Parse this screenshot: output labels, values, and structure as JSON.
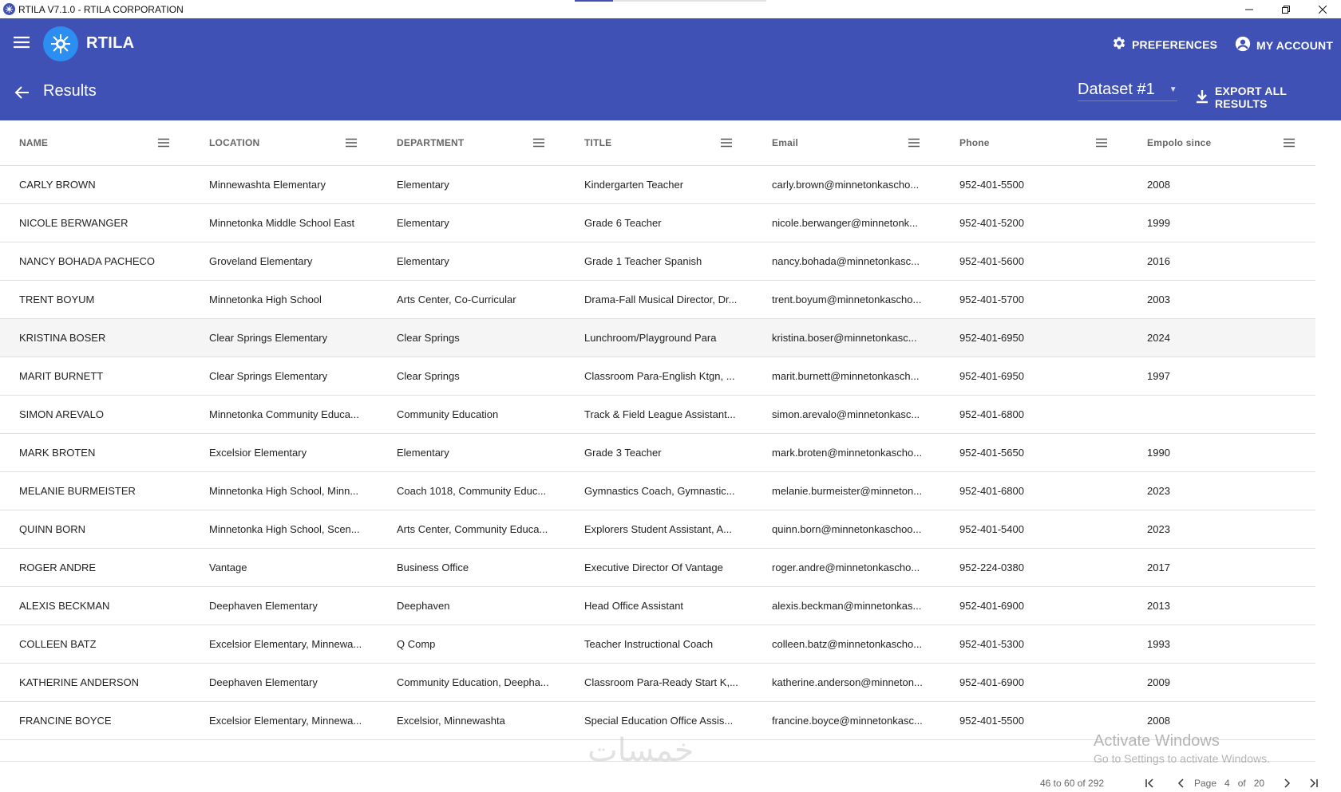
{
  "window": {
    "title": "RTILA V7.1.0 - RTILA CORPORATION",
    "loading_progress": 0.2
  },
  "header": {
    "brand": "RTILA",
    "preferences_label": "PREFERENCES",
    "account_label": "MY ACCOUNT",
    "page_title": "Results",
    "dataset_label": "Dataset #1",
    "export_label": "EXPORT ALL RESULTS",
    "accent": "#3f51b5"
  },
  "table": {
    "columns": [
      {
        "label": "NAME"
      },
      {
        "label": "LOCATION"
      },
      {
        "label": "DEPARTMENT"
      },
      {
        "label": "TITLE"
      },
      {
        "label": "Email"
      },
      {
        "label": "Phone"
      },
      {
        "label": "Empolo since"
      }
    ],
    "rows": [
      [
        "CARLY BROWN",
        "Minnewashta Elementary",
        "Elementary",
        "Kindergarten Teacher",
        "carly.brown@minnetonkascho...",
        "952-401-5500",
        "2008"
      ],
      [
        "NICOLE BERWANGER",
        "Minnetonka Middle School East",
        "Elementary",
        "Grade 6 Teacher",
        "nicole.berwanger@minnetonk...",
        "952-401-5200",
        "1999"
      ],
      [
        "NANCY BOHADA PACHECO",
        "Groveland Elementary",
        "Elementary",
        "Grade 1 Teacher Spanish",
        "nancy.bohada@minnetonkasc...",
        "952-401-5600",
        "2016"
      ],
      [
        "TRENT BOYUM",
        "Minnetonka High School",
        "Arts Center, Co-Curricular",
        "Drama-Fall Musical Director, Dr...",
        "trent.boyum@minnetonkascho...",
        "952-401-5700",
        "2003"
      ],
      [
        "KRISTINA BOSER",
        "Clear Springs Elementary",
        "Clear Springs",
        "Lunchroom/Playground Para",
        "kristina.boser@minnetonkasc...",
        "952-401-6950",
        "2024"
      ],
      [
        "MARIT BURNETT",
        "Clear Springs Elementary",
        "Clear Springs",
        "Classroom Para-English Ktgn, ...",
        "marit.burnett@minnetonkasch...",
        "952-401-6950",
        "1997"
      ],
      [
        "SIMON AREVALO",
        "Minnetonka Community Educa...",
        "Community Education",
        "Track & Field League Assistant...",
        "simon.arevalo@minnetonkasc...",
        "952-401-6800",
        ""
      ],
      [
        "MARK BROTEN",
        "Excelsior Elementary",
        "Elementary",
        "Grade 3 Teacher",
        "mark.broten@minnetonkascho...",
        "952-401-5650",
        "1990"
      ],
      [
        "MELANIE BURMEISTER",
        "Minnetonka High School, Minn...",
        "Coach 1018, Community Educ...",
        "Gymnastics Coach, Gymnastic...",
        "melanie.burmeister@minneton...",
        "952-401-6800",
        "2023"
      ],
      [
        "QUINN BORN",
        "Minnetonka High School, Scen...",
        "Arts Center, Community Educa...",
        "Explorers Student Assistant, A...",
        "quinn.born@minnetonkaschoo...",
        "952-401-5400",
        "2023"
      ],
      [
        "ROGER ANDRE",
        "Vantage",
        "Business Office",
        "Executive Director Of Vantage",
        "roger.andre@minnetonkascho...",
        "952-224-0380",
        "2017"
      ],
      [
        "ALEXIS BECKMAN",
        "Deephaven Elementary",
        "Deephaven",
        "Head Office Assistant",
        "alexis.beckman@minnetonkas...",
        "952-401-6900",
        "2013"
      ],
      [
        "COLLEEN BATZ",
        "Excelsior Elementary, Minnewa...",
        "Q Comp",
        "Teacher Instructional Coach",
        "colleen.batz@minnetonkascho...",
        "952-401-5300",
        "1993"
      ],
      [
        "KATHERINE ANDERSON",
        "Deephaven Elementary",
        "Community Education, Deepha...",
        "Classroom Para-Ready Start K,...",
        "katherine.anderson@minneton...",
        "952-401-6900",
        "2009"
      ],
      [
        "FRANCINE BOYCE",
        "Excelsior Elementary, Minnewa...",
        "Excelsior, Minnewashta",
        "Special Education Office Assis...",
        "francine.boyce@minnetonkasc...",
        "952-401-5500",
        "2008"
      ]
    ]
  },
  "pagination": {
    "range": "46 to 60 of 292",
    "page_word": "Page",
    "current_page": "4",
    "of_word": "of",
    "total_pages": "20"
  },
  "watermark": {
    "activate_title": "Activate Windows",
    "activate_sub": "Go to Settings to activate Windows.",
    "logo_text": "خمسات"
  }
}
